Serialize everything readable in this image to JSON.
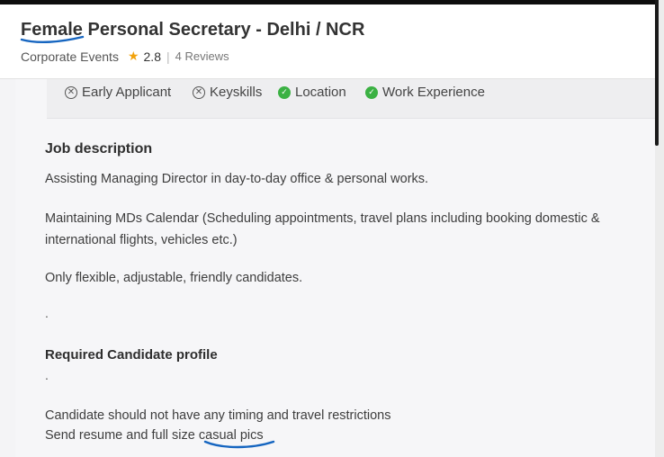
{
  "header": {
    "title_emph": "Female",
    "title_rest": " Personal Secretary - Delhi / NCR",
    "company": "Corporate Events",
    "rating": "2.8",
    "separator": "|",
    "reviews": "4 Reviews"
  },
  "highlights": [
    {
      "label": "Early Applicant",
      "status": "not-matched"
    },
    {
      "label": "Keyskills",
      "status": "not-matched"
    },
    {
      "label": "Location",
      "status": "matched"
    },
    {
      "label": "Work Experience",
      "status": "matched"
    }
  ],
  "job_description": {
    "heading": "Job description",
    "line1": "Assisting Managing Director in day-to-day office & personal works.",
    "line2a": "Maintaining MDs Calendar (Scheduling appointments, travel plans including booking domestic &",
    "line2b": "international flights, vehicles etc.)",
    "line3": "Only flexible, adjustable, friendly candidates.",
    "dot": "."
  },
  "candidate_profile": {
    "heading": "Required Candidate profile",
    "dot": ".",
    "line1": "Candidate should not have any timing and travel restrictions",
    "line2_prefix": "Send resume and full size ",
    "line2_emph": "casual pics"
  },
  "icons": {
    "star": "star-icon",
    "cross": "cross-circle-icon",
    "check": "check-circle-icon"
  },
  "colors": {
    "annotation": "#1565c0",
    "star": "#f2a20b",
    "matched": "#3bb143"
  }
}
